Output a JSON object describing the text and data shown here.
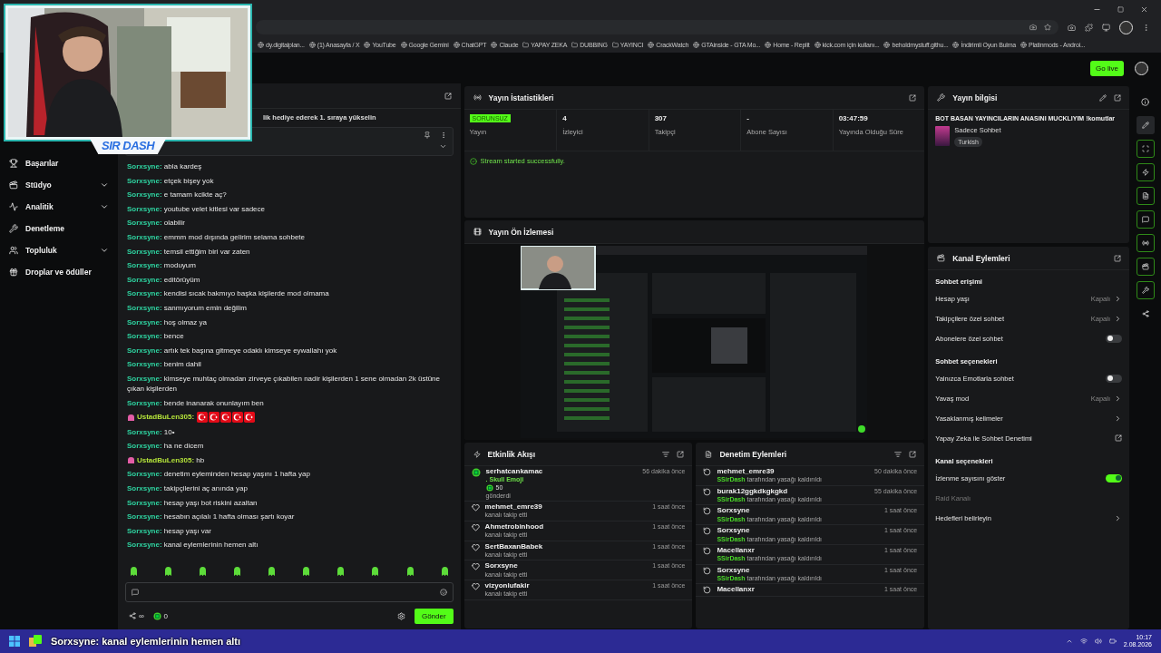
{
  "browser": {
    "bookmarks": [
      {
        "kind": "site",
        "label": "dy.digitalplan..."
      },
      {
        "kind": "site",
        "label": "(1) Anasayfa / X"
      },
      {
        "kind": "site",
        "label": "YouTube"
      },
      {
        "kind": "site",
        "label": "Google Gemini"
      },
      {
        "kind": "site",
        "label": "ChatGPT"
      },
      {
        "kind": "site",
        "label": "Claude"
      },
      {
        "kind": "folder",
        "label": "YAPAY ZEKA"
      },
      {
        "kind": "folder",
        "label": "DUBBING"
      },
      {
        "kind": "folder",
        "label": "YAYINCI"
      },
      {
        "kind": "site",
        "label": "CrackWatch"
      },
      {
        "kind": "site",
        "label": "GTAinside - GTA Mo..."
      },
      {
        "kind": "site",
        "label": "Home - Replit"
      },
      {
        "kind": "site",
        "label": "kick.com için kullanı..."
      },
      {
        "kind": "site",
        "label": "beholdmystuff.githu..."
      },
      {
        "kind": "site",
        "label": "İndirimli Oyun Bulma"
      },
      {
        "kind": "site",
        "label": "Platinmods - Androi..."
      }
    ]
  },
  "header": {
    "go_live": "Go live"
  },
  "webcam": {
    "kind": "picture",
    "logo": "SIR DASH"
  },
  "sidebar": {
    "items": [
      {
        "label": "Başarılar",
        "expandable": false
      },
      {
        "label": "Stüdyo",
        "expandable": true
      },
      {
        "label": "Analitik",
        "expandable": true
      },
      {
        "label": "Denetleme",
        "expandable": false
      },
      {
        "label": "Topluluk",
        "expandable": true
      },
      {
        "label": "Droplar ve ödüller",
        "expandable": false
      }
    ]
  },
  "chat": {
    "separator": ":",
    "banner": "lik hediye ederek 1. sıraya yükselin",
    "messages": [
      {
        "user": "Sorxsyne",
        "color": "#2ed3a0",
        "badge": false,
        "text": "abla kardeş"
      },
      {
        "user": "Sorxsyne",
        "color": "#2ed3a0",
        "badge": false,
        "text": "etçek bişey yok"
      },
      {
        "user": "Sorxsyne",
        "color": "#2ed3a0",
        "badge": false,
        "text": "e tamam kcikte aç?"
      },
      {
        "user": "Sorxsyne",
        "color": "#2ed3a0",
        "badge": false,
        "text": "youtube velet kitlesi var sadece"
      },
      {
        "user": "Sorxsyne",
        "color": "#2ed3a0",
        "badge": false,
        "text": "olabilir"
      },
      {
        "user": "Sorxsyne",
        "color": "#2ed3a0",
        "badge": false,
        "text": "emmm mod dışında gelirim selama sohbete"
      },
      {
        "user": "Sorxsyne",
        "color": "#2ed3a0",
        "badge": false,
        "text": "temsil ettiğim biri var zaten"
      },
      {
        "user": "Sorxsyne",
        "color": "#2ed3a0",
        "badge": false,
        "text": "moduyum"
      },
      {
        "user": "Sorxsyne",
        "color": "#2ed3a0",
        "badge": false,
        "text": "editörüyüm"
      },
      {
        "user": "Sorxsyne",
        "color": "#2ed3a0",
        "badge": false,
        "text": "kendisi sıcak bakmıyo başka kişilerde mod olmama"
      },
      {
        "user": "Sorxsyne",
        "color": "#2ed3a0",
        "badge": false,
        "text": "sanmıyorum emin değilim"
      },
      {
        "user": "Sorxsyne",
        "color": "#2ed3a0",
        "badge": false,
        "text": "hoş olmaz ya"
      },
      {
        "user": "Sorxsyne",
        "color": "#2ed3a0",
        "badge": false,
        "text": "bence"
      },
      {
        "user": "Sorxsyne",
        "color": "#2ed3a0",
        "badge": false,
        "text": "artık tek başına gitmeye odaklı kimseye eywallahı yok"
      },
      {
        "user": "Sorxsyne",
        "color": "#2ed3a0",
        "badge": false,
        "text": "benim dahil"
      },
      {
        "user": "Sorxsyne",
        "color": "#2ed3a0",
        "badge": false,
        "text": "kimseye muhtaç olmadan zirveye çıkabilen nadir kişilerden 1 sene olmadan 2k üstüne çıkan kişilerden"
      },
      {
        "user": "Sorxsyne",
        "color": "#2ed3a0",
        "badge": false,
        "text": "bende inanarak onunlayım ben"
      },
      {
        "user": "UstadBuLen305",
        "color": "#b6e53a",
        "badge": true,
        "emotes": [
          {
            "kind": "flag"
          },
          {
            "kind": "flag"
          },
          {
            "kind": "flag"
          },
          {
            "kind": "flag"
          },
          {
            "kind": "flag"
          }
        ]
      },
      {
        "user": "Sorxsyne",
        "color": "#2ed3a0",
        "badge": false,
        "text": "10•"
      },
      {
        "user": "Sorxsyne",
        "color": "#2ed3a0",
        "badge": false,
        "text": "ha ne dicem"
      },
      {
        "user": "UstadBuLen305",
        "color": "#b6e53a",
        "badge": true,
        "text": "hb"
      },
      {
        "user": "Sorxsyne",
        "color": "#2ed3a0",
        "badge": false,
        "text": "denetim eyleminden hesap yaşını 1 hafta yap"
      },
      {
        "user": "Sorxsyne",
        "color": "#2ed3a0",
        "badge": false,
        "text": "takipçilerini aç anında yap"
      },
      {
        "user": "Sorxsyne",
        "color": "#2ed3a0",
        "badge": false,
        "text": "hesap yaşı bot riskini azaltan"
      },
      {
        "user": "Sorxsyne",
        "color": "#2ed3a0",
        "badge": false,
        "text": "hesabın açılalı 1 hafta olması şartı koyar"
      },
      {
        "user": "Sorxsyne",
        "color": "#2ed3a0",
        "badge": false,
        "text": "hesap yaşı var"
      },
      {
        "user": "Sorxsyne",
        "color": "#2ed3a0",
        "badge": false,
        "text": "kanal eylemlerinin hemen altı"
      }
    ],
    "points": "∞",
    "coins": "0",
    "send": "Gönder"
  },
  "stats": {
    "title": "Yayın İstatistikleri",
    "status": {
      "badge": "SORUNSUZ",
      "label": "Yayın"
    },
    "items": [
      {
        "value": "4",
        "label": "İzleyici"
      },
      {
        "value": "307",
        "label": "Takipçi"
      },
      {
        "value": "-",
        "label": "Abone Sayısı"
      },
      {
        "value": "03:47:59",
        "label": "Yayında Olduğu Süre"
      }
    ],
    "notice": "Stream started successfully."
  },
  "preview": {
    "title": "Yayın Ön İzlemesi",
    "kind": "picture"
  },
  "activity": {
    "title": "Etkinlik Akışı",
    "events": [
      {
        "kind": "gift",
        "user": "serhatcankamac",
        "time": "56 dakika önce",
        "item": ". Skull Emoji",
        "amount": "50",
        "detail": "gönderdi"
      },
      {
        "kind": "follow",
        "user": "mehmet_emre39",
        "time": "1 saat önce",
        "detail": "kanalı takip etti"
      },
      {
        "kind": "follow",
        "user": "Ahmetrobinhood",
        "time": "1 saat önce",
        "detail": "kanalı takip etti"
      },
      {
        "kind": "follow",
        "user": "SertBaxanBabek",
        "time": "1 saat önce",
        "detail": "kanalı takip etti"
      },
      {
        "kind": "follow",
        "user": "Sorxsyne",
        "time": "1 saat önce",
        "detail": "kanalı takip etti"
      },
      {
        "kind": "follow",
        "user": "vizyonlufakir",
        "time": "1 saat önce",
        "detail": "kanalı takip etti"
      }
    ]
  },
  "moderation": {
    "title": "Denetim Eylemleri",
    "actions": [
      {
        "user": "mehmet_emre39",
        "time": "50 dakika önce",
        "by": "SSirDash",
        "detail": "tarafından yasağı kaldırıldı"
      },
      {
        "user": "burak12ggkdkgkgkd",
        "time": "55 dakika önce",
        "by": "SSirDash",
        "detail": "tarafından yasağı kaldırıldı"
      },
      {
        "user": "Sorxsyne",
        "time": "1 saat önce",
        "by": "SSirDash",
        "detail": "tarafından yasağı kaldırıldı"
      },
      {
        "user": "Sorxsyne",
        "time": "1 saat önce",
        "by": "SSirDash",
        "detail": "tarafından yasağı kaldırıldı"
      },
      {
        "user": "Macellanxr",
        "time": "1 saat önce",
        "by": "SSirDash",
        "detail": "tarafından yasağı kaldırıldı"
      },
      {
        "user": "Sorxsyne",
        "time": "1 saat önce",
        "by": "SSirDash",
        "detail": "tarafından yasağı kaldırıldı"
      },
      {
        "user": "Macellanxr",
        "time": "1 saat önce"
      }
    ]
  },
  "stream_info": {
    "title": "Yayın bilgisi",
    "stream_title": "BOT BASAN YAYINCILARIN ANASINI MUCKLIYIM !komutlar",
    "category": "Sadece Sohbet",
    "tag": "Turkish"
  },
  "channel_actions": {
    "title": "Kanal Eylemleri",
    "sections": [
      {
        "heading": "Sohbet erişimi",
        "rows": [
          {
            "kind": "value",
            "label": "Hesap yaşı",
            "value": "Kapalı"
          },
          {
            "kind": "value",
            "label": "Takipçilere özel sohbet",
            "value": "Kapalı"
          },
          {
            "kind": "toggle",
            "label": "Abonelere özel sohbet",
            "on": false
          }
        ]
      },
      {
        "heading": "Sohbet seçenekleri",
        "rows": [
          {
            "kind": "toggle",
            "label": "Yalnızca Emotlarla sohbet",
            "on": false
          },
          {
            "kind": "value",
            "label": "Yavaş mod",
            "value": "Kapalı"
          },
          {
            "kind": "link",
            "label": "Yasaklanmış kelimeler"
          },
          {
            "kind": "external",
            "label": "Yapay Zeka ile Sohbet Denetimi"
          }
        ]
      },
      {
        "heading": "Kanal seçenekleri",
        "rows": [
          {
            "kind": "toggle",
            "label": "İzlenme sayısını göster",
            "on": true
          },
          {
            "kind": "muted",
            "label": "Raid Kanalı"
          },
          {
            "kind": "link",
            "label": "Hedefleri belirleyin"
          }
        ]
      }
    ]
  },
  "caption": "Sorxsyne: kanal eylemlerinin hemen altı",
  "taskbar": {
    "time": "10:17",
    "date": "2.08.2026"
  }
}
